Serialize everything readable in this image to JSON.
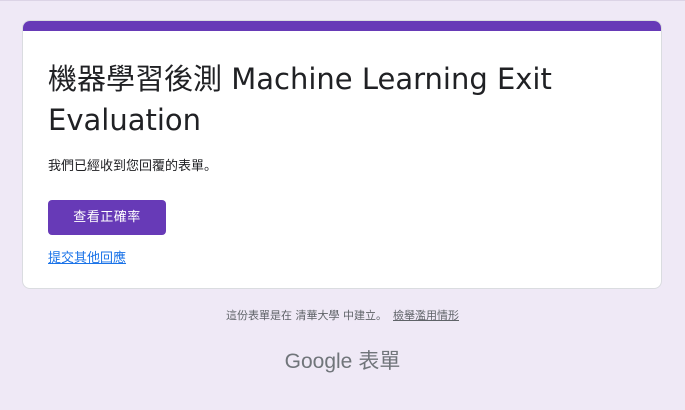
{
  "form": {
    "title": "機器學習後測 Machine Learning Exit Evaluation",
    "confirmation": "我們已經收到您回覆的表單。",
    "view_score_button": "查看正確率",
    "submit_another_link": "提交其他回應"
  },
  "footer": {
    "created_in": "這份表單是在 清華大學 中建立。",
    "report_abuse": "檢舉濫用情形"
  },
  "branding": {
    "google": "Google",
    "forms": "表單"
  },
  "colors": {
    "accent": "#673ab7",
    "background": "#efe9f6",
    "link": "#1a73e8"
  }
}
